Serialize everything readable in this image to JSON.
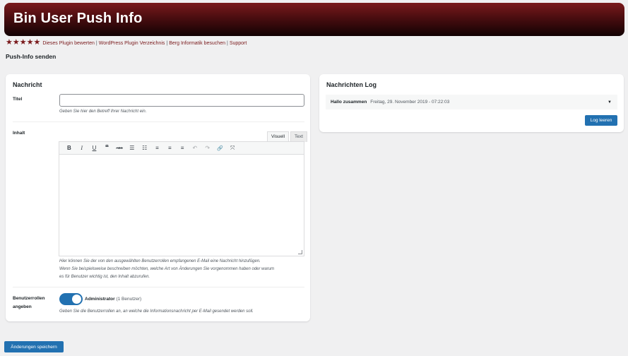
{
  "header": {
    "title": "Bin User Push Info"
  },
  "rating": {
    "stars": 5
  },
  "links": [
    {
      "label": "Dieses Plugin bewerten"
    },
    {
      "label": "WordPress Plugin Verzeichnis"
    },
    {
      "label": "Berg Informatik besuchen"
    },
    {
      "label": "Support"
    }
  ],
  "link_separator": "|",
  "page_subtitle": "Push-Info senden",
  "message_card": {
    "heading": "Nachricht",
    "title_field": {
      "label": "Titel",
      "value": "",
      "placeholder": "",
      "hint": "Geben Sie hier den Betreff Ihrer Nachricht ein."
    },
    "content_field": {
      "label": "Inhalt",
      "tabs": {
        "visual": "Visuell",
        "text": "Text"
      },
      "toolbar_icons": [
        "bold-icon",
        "italic-icon",
        "underline-icon",
        "blockquote-icon",
        "strikethrough-icon",
        "bullet-list-icon",
        "numbered-list-icon",
        "align-left-icon",
        "align-center-icon",
        "align-right-icon",
        "undo-icon",
        "redo-icon",
        "link-icon",
        "fullscreen-icon"
      ],
      "toolbar_glyphs": {
        "bold": "B",
        "italic": "I",
        "underline": "U",
        "blockquote": "❝",
        "strike": "ABC",
        "ul": "☰",
        "ol": "☷",
        "left": "≡",
        "center": "≡",
        "right": "≡",
        "undo": "↶",
        "redo": "↷",
        "link": "🔗",
        "fullscreen": "⤧"
      },
      "hint_line1": "Hier können Sie der von den ausgewählten Benutzerrollen empfangenen E-Mail eine Nachricht hinzufügen.",
      "hint_line2": "Wenn Sie beispielsweise beschreiben möchten, welche Art von Änderungen Sie vorgenommen haben oder warum",
      "hint_line3": "es für Benutzer wichtig ist, den Inhalt abzurufen."
    },
    "roles_field": {
      "label_line1": "Benutzerrollen",
      "label_line2": "angeben",
      "toggle_on": true,
      "role_name": "Administrator",
      "role_count": "(1 Benutzer)",
      "hint": "Geben Sie die Benutzerrollen an, an welche die Informationsnachricht per E-Mail gesendet werden soll."
    }
  },
  "log_card": {
    "heading": "Nachrichten Log",
    "entries": [
      {
        "title": "Hallo zusammen",
        "date": "Freitag, 29. November 2019 - 07:22:03",
        "caret": "▼"
      }
    ],
    "clear_button": "Log leeren"
  },
  "save_button": "Änderungen speichern",
  "colors": {
    "accent": "#2271b1",
    "header_dark": "#4a0d10",
    "link": "#7a1a1c"
  }
}
